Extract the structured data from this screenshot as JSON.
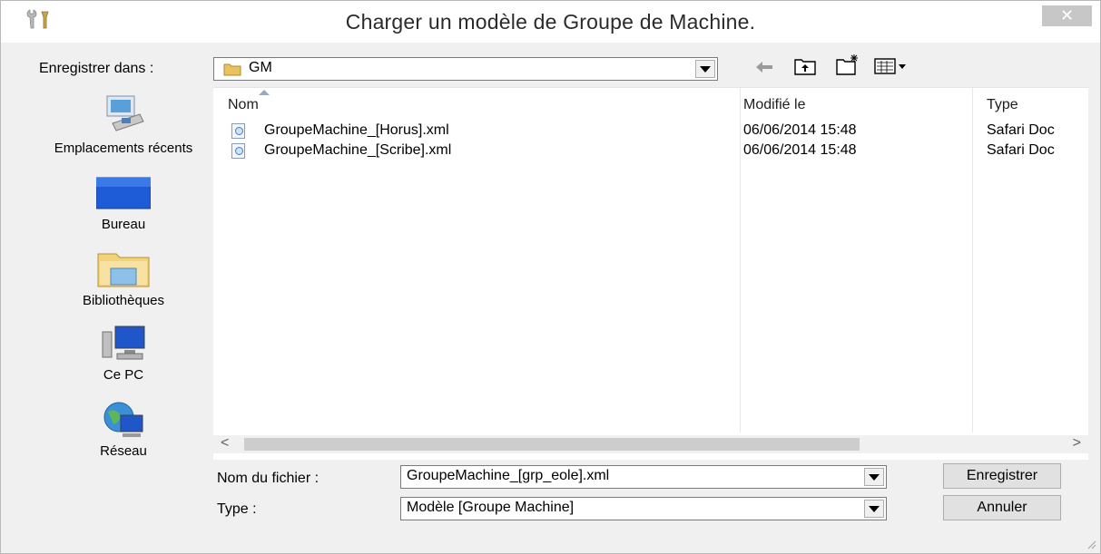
{
  "window": {
    "title": "Charger un modèle de Groupe de Machine."
  },
  "save_in": {
    "label": "Enregistrer dans :",
    "value": "GM"
  },
  "places": [
    {
      "label": "Emplacements récents",
      "icon": "recent-places-icon"
    },
    {
      "label": "Bureau",
      "icon": "desktop-icon"
    },
    {
      "label": "Bibliothèques",
      "icon": "libraries-icon"
    },
    {
      "label": "Ce PC",
      "icon": "computer-icon"
    },
    {
      "label": "Réseau",
      "icon": "network-icon"
    }
  ],
  "file_list": {
    "columns": [
      "Nom",
      "Modifié le",
      "Type"
    ],
    "rows": [
      {
        "name": "GroupeMachine_[Horus].xml",
        "modified": "06/06/2014 15:48",
        "type": "Safari Doc"
      },
      {
        "name": "GroupeMachine_[Scribe].xml",
        "modified": "06/06/2014 15:48",
        "type": "Safari Doc"
      }
    ]
  },
  "filename": {
    "label": "Nom du fichier :",
    "value": "GroupeMachine_[grp_eole].xml"
  },
  "filetype": {
    "label": "Type :",
    "value": "Modèle [Groupe Machine]"
  },
  "buttons": {
    "save": "Enregistrer",
    "cancel": "Annuler"
  },
  "colors": {
    "close_button": "#c7c7c7",
    "dialog_bg": "#f0f0f0",
    "list_bg": "#ffffff"
  }
}
